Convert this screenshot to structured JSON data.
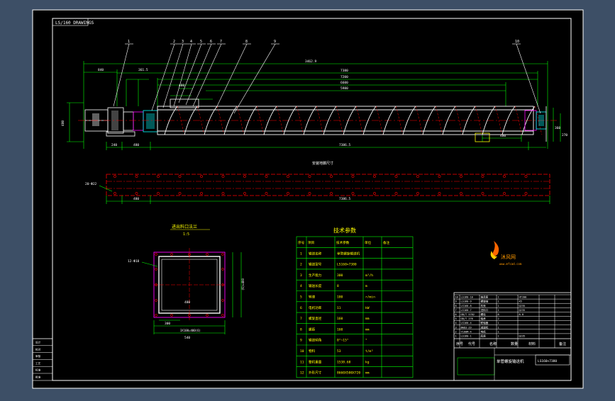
{
  "drawing": {
    "corner_code": "LS/160 DRAWINGS",
    "part_numbers": [
      "1",
      "2",
      "3",
      "4",
      "5",
      "6",
      "7",
      "8",
      "9",
      "10"
    ],
    "overall_dims": [
      "3462.9",
      "7380",
      "7200",
      "6600",
      "5980"
    ],
    "left_dims": [
      "840",
      "361.5",
      "480"
    ],
    "bottom_dims": [
      "240",
      "480",
      "7386.5",
      "480"
    ],
    "side_dims": [
      "480",
      "360",
      "270"
    ],
    "section_title": "安装地脚尺寸",
    "plan_dims": [
      "20-Φ22",
      "7386.5",
      "480"
    ],
    "flange_title": "进出料口法兰",
    "flange_scale": "1:5",
    "flange_holes": "12-Φ18",
    "flange_dims": [
      "480",
      "540",
      "300",
      "3X100=400(6)",
      "(6)=400"
    ]
  },
  "tech_table": {
    "title": "技术参数",
    "headers": [
      "序号",
      "项目",
      "技术参数",
      "单位",
      "备注"
    ],
    "rows": [
      [
        "1",
        "输送名称",
        "单管螺旋输送机",
        "",
        ""
      ],
      [
        "2",
        "输送型号",
        "LS160×7380",
        "",
        ""
      ],
      [
        "3",
        "生产能力",
        "300",
        "m³/h",
        ""
      ],
      [
        "4",
        "输送长度",
        "8",
        "m",
        ""
      ],
      [
        "5",
        "转速",
        "180",
        "r/min",
        ""
      ],
      [
        "6",
        "电机功率",
        "11",
        "kW",
        ""
      ],
      [
        "7",
        "螺旋直径",
        "160",
        "mm",
        ""
      ],
      [
        "8",
        "螺距",
        "160",
        "mm",
        ""
      ],
      [
        "9",
        "输送倾角",
        "0°~15°",
        "°",
        ""
      ],
      [
        "10",
        "物料",
        "53",
        "t/m³",
        ""
      ],
      [
        "11",
        "整机重量",
        "1538.68",
        "kg",
        ""
      ],
      [
        "12",
        "外形尺寸",
        "8660X580X720",
        "mm",
        ""
      ]
    ]
  },
  "logo": {
    "name": "沐风网",
    "url": "www.mfcad.com"
  },
  "title_block": {
    "main_title": "单管螺旋输送机",
    "drawing_no": "LS160×7380",
    "header_cells": [
      "序号",
      "代号",
      "名称",
      "数量",
      "材料",
      "备注"
    ],
    "parts_rows": [
      [
        "10",
        "LS160-10",
        "轴承座",
        "1",
        "HT200",
        "",
        ""
      ],
      [
        "9",
        "LS160-9",
        "螺旋轴",
        "1",
        "45",
        "",
        ""
      ],
      [
        "8",
        "LS160-8",
        "机壳",
        "1",
        "Q235",
        "",
        ""
      ],
      [
        "7",
        "LS160-7",
        "进料口",
        "1",
        "Q235",
        "",
        ""
      ],
      [
        "6",
        "GB/T 5782",
        "螺栓",
        "8",
        "8.8",
        "",
        ""
      ],
      [
        "5",
        "GB/T 276",
        "轴承",
        "2",
        "",
        "",
        ""
      ],
      [
        "4",
        "LS160-4",
        "联轴器",
        "1",
        "",
        "",
        ""
      ],
      [
        "3",
        "BWD3-29",
        "减速机",
        "1",
        "",
        "",
        ""
      ],
      [
        "2",
        "Y160M-4",
        "电机",
        "1",
        "",
        "",
        ""
      ],
      [
        "1",
        "LS160-1",
        "底座",
        "1",
        "Q235",
        "",
        ""
      ]
    ]
  },
  "left_block": [
    "设计",
    "校对",
    "审核",
    "工艺",
    "标准",
    "批准"
  ],
  "colors": {
    "background": "#000000",
    "frame": "#ffffff",
    "geometry": "#ffffff",
    "dimension": "#00ff00",
    "centerline": "#ff0000",
    "accent": "#ffff00",
    "cyan": "#00ffff",
    "magenta": "#ff00ff"
  }
}
